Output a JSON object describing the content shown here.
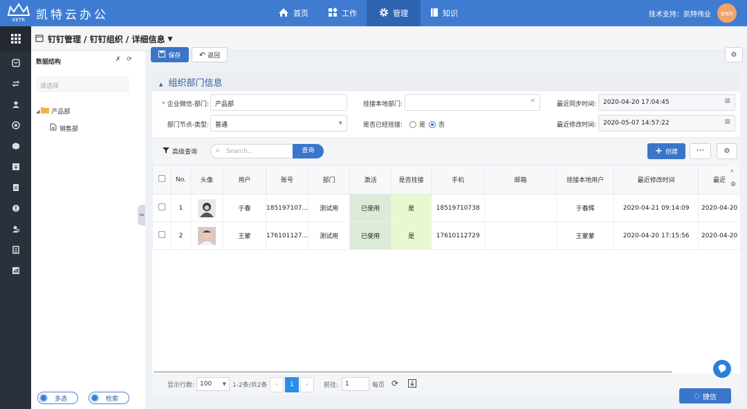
{
  "header": {
    "logo_text": "KETR",
    "app_title": "凯特云办公",
    "nav": [
      {
        "label": "首页",
        "icon": "home-icon"
      },
      {
        "label": "工作",
        "icon": "apps-icon"
      },
      {
        "label": "管理",
        "icon": "gear-icon",
        "active": true
      },
      {
        "label": "知识",
        "icon": "book-icon"
      }
    ],
    "support": "技术支持：凯特伟业",
    "avatar_text": "管理员"
  },
  "breadcrumb": "钉钉管理 / 钉钉组织 / 详细信息",
  "tree": {
    "title": "数据结构",
    "search_placeholder": "请选择",
    "root": "产品部",
    "child": "销售部",
    "multi_btn": "多选",
    "search_btn": "检索"
  },
  "actions": {
    "save": "保存",
    "back": "返回"
  },
  "section": {
    "title": "组织部门信息"
  },
  "form": {
    "dept_label": "企业微信-部门:",
    "dept_value": "产品部",
    "local_dept_label": "挂接本地部门:",
    "local_dept_value": "",
    "sync_label": "最近同步时间:",
    "sync_value": "2020-04-20 17:04:45",
    "type_label": "部门节点-类型:",
    "type_value": "普通",
    "linked_label": "是否已经挂接:",
    "linked_yes": "是",
    "linked_no": "否",
    "modify_label": "最近修改时间:",
    "modify_value": "2020-05-07 14:57:22"
  },
  "grid_toolbar": {
    "advanced": "高级查询",
    "search_placeholder": "Search...",
    "search_btn": "查询",
    "create": "创建",
    "more": "···"
  },
  "table": {
    "columns": [
      "No.",
      "头像",
      "用户",
      "账号",
      "部门",
      "激活",
      "是否挂接",
      "手机",
      "邮箱",
      "挂接本地用户",
      "最近修改时间",
      "最近"
    ],
    "rows": [
      {
        "no": "1",
        "user": "于春",
        "account": "185197107...",
        "dept": "测试用",
        "active": "已使用",
        "linked": "是",
        "phone": "18519710738",
        "email": "",
        "local_user": "于春辉",
        "modified": "2020-04-21 09:14:09",
        "recent": "2020-04-20"
      },
      {
        "no": "2",
        "user": "王蒙",
        "account": "176101127...",
        "dept": "测试用",
        "active": "已使用",
        "linked": "是",
        "phone": "17610112729",
        "email": "",
        "local_user": "王蒙蒙",
        "modified": "2020-04-20 17:15:56",
        "recent": "2020-04-20"
      }
    ]
  },
  "pager": {
    "rows_label": "显示行数:",
    "rows_value": "100",
    "range": "1-2条/共2条",
    "page": "1",
    "goto_label": "前往:",
    "goto_value": "1",
    "per_page": "每页"
  },
  "float": {
    "jiexin": "捷信"
  },
  "colors": {
    "primary": "#3a75c9",
    "topbar": "#3f7cd1",
    "rail": "#2b313b"
  }
}
